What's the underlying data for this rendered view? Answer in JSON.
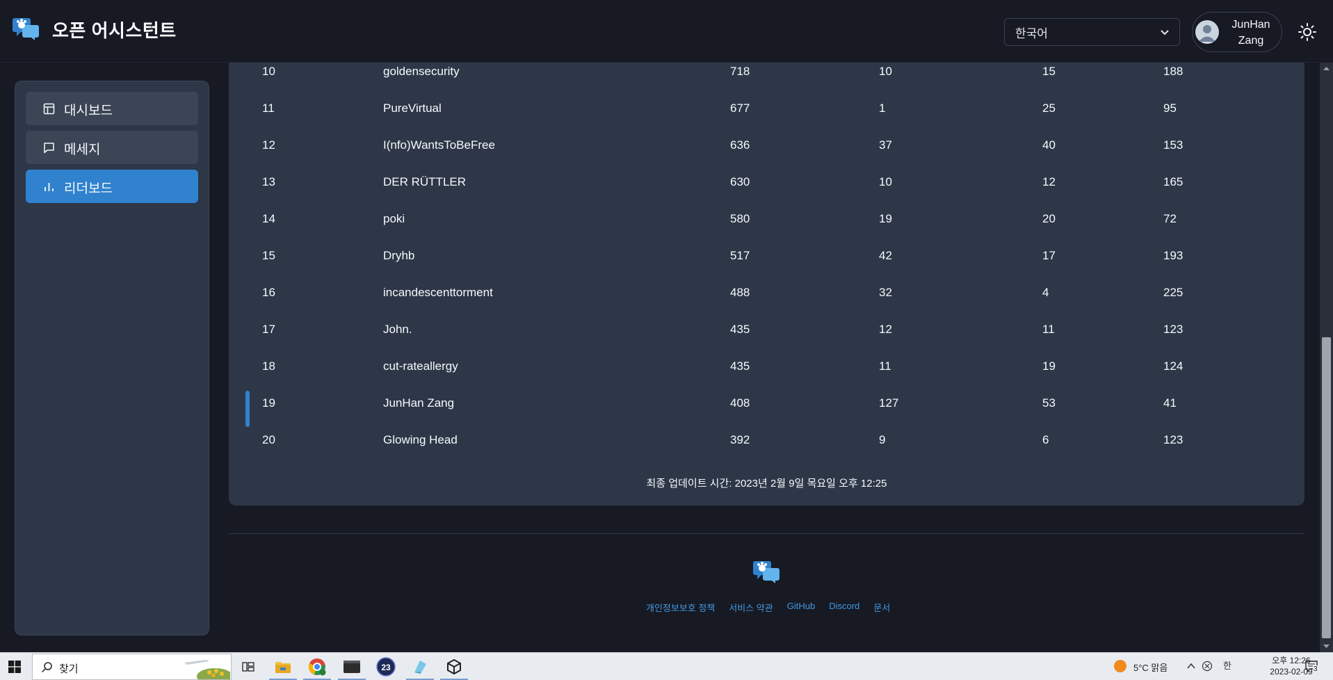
{
  "header": {
    "app_title": "오픈 어시스턴트",
    "language_selected": "한국어",
    "user_name_line1": "JunHan",
    "user_name_line2": "Zang"
  },
  "sidebar": {
    "items": [
      {
        "label": "대시보드",
        "icon": "dashboard-icon",
        "active": false
      },
      {
        "label": "메세지",
        "icon": "message-icon",
        "active": false
      },
      {
        "label": "리더보드",
        "icon": "bar-chart-icon",
        "active": true
      }
    ]
  },
  "leaderboard": {
    "rows": [
      {
        "rank": "10",
        "name": "goldensecurity",
        "score": "718",
        "v1": "10",
        "v2": "15",
        "v3": "188"
      },
      {
        "rank": "11",
        "name": "PureVirtual",
        "score": "677",
        "v1": "1",
        "v2": "25",
        "v3": "95"
      },
      {
        "rank": "12",
        "name": "I(nfo)WantsToBeFree",
        "score": "636",
        "v1": "37",
        "v2": "40",
        "v3": "153"
      },
      {
        "rank": "13",
        "name": "DER RÜTTLER",
        "score": "630",
        "v1": "10",
        "v2": "12",
        "v3": "165"
      },
      {
        "rank": "14",
        "name": "poki",
        "score": "580",
        "v1": "19",
        "v2": "20",
        "v3": "72"
      },
      {
        "rank": "15",
        "name": "Dryhb",
        "score": "517",
        "v1": "42",
        "v2": "17",
        "v3": "193"
      },
      {
        "rank": "16",
        "name": "incandescenttorment",
        "score": "488",
        "v1": "32",
        "v2": "4",
        "v3": "225"
      },
      {
        "rank": "17",
        "name": "John.",
        "score": "435",
        "v1": "12",
        "v2": "11",
        "v3": "123"
      },
      {
        "rank": "18",
        "name": "cut-rateallergy",
        "score": "435",
        "v1": "11",
        "v2": "19",
        "v3": "124"
      },
      {
        "rank": "19",
        "name": "JunHan Zang",
        "score": "408",
        "v1": "127",
        "v2": "53",
        "v3": "41"
      },
      {
        "rank": "20",
        "name": "Glowing Head",
        "score": "392",
        "v1": "9",
        "v2": "6",
        "v3": "123"
      }
    ],
    "updated": "최종 업데이트 시간: 2023년 2월 9일 목요일 오후 12:25"
  },
  "footer": {
    "links": [
      "개인정보보호 정책",
      "서비스 약관",
      "GitHub",
      "Discord",
      "문서"
    ]
  },
  "taskbar": {
    "search_placeholder": "찾기",
    "weather": "5°C  맑음",
    "ime": "한",
    "time": "오후 12:26",
    "date": "2023-02-09",
    "notification_count": "3",
    "calendar_badge": "23"
  },
  "colors": {
    "accent": "#3182ce",
    "link": "#4299e1",
    "card": "#2d3748",
    "background": "#171923"
  }
}
